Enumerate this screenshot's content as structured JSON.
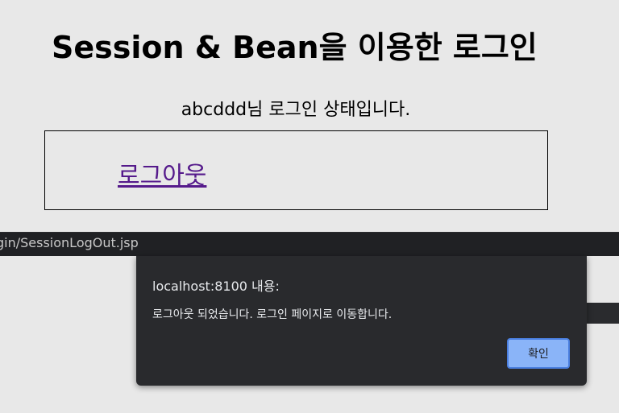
{
  "page": {
    "heading": "Session & Bean을 이용한 로그인",
    "status_text": "abcddd님 로그인 상태입니다.",
    "logout_link": "로그아웃"
  },
  "status_bar": {
    "url": "gin/SessionLogOut.jsp"
  },
  "alert_dialog": {
    "title": "localhost:8100 내용:",
    "message": "로그아웃 되었습니다. 로그인 페이지로 이동합니다.",
    "ok_label": "확인"
  },
  "colors": {
    "page_background": "#e8e8e8",
    "visited_link": "#551a8b",
    "dialog_background": "#292a2d",
    "button_background": "#8ab4f8"
  }
}
